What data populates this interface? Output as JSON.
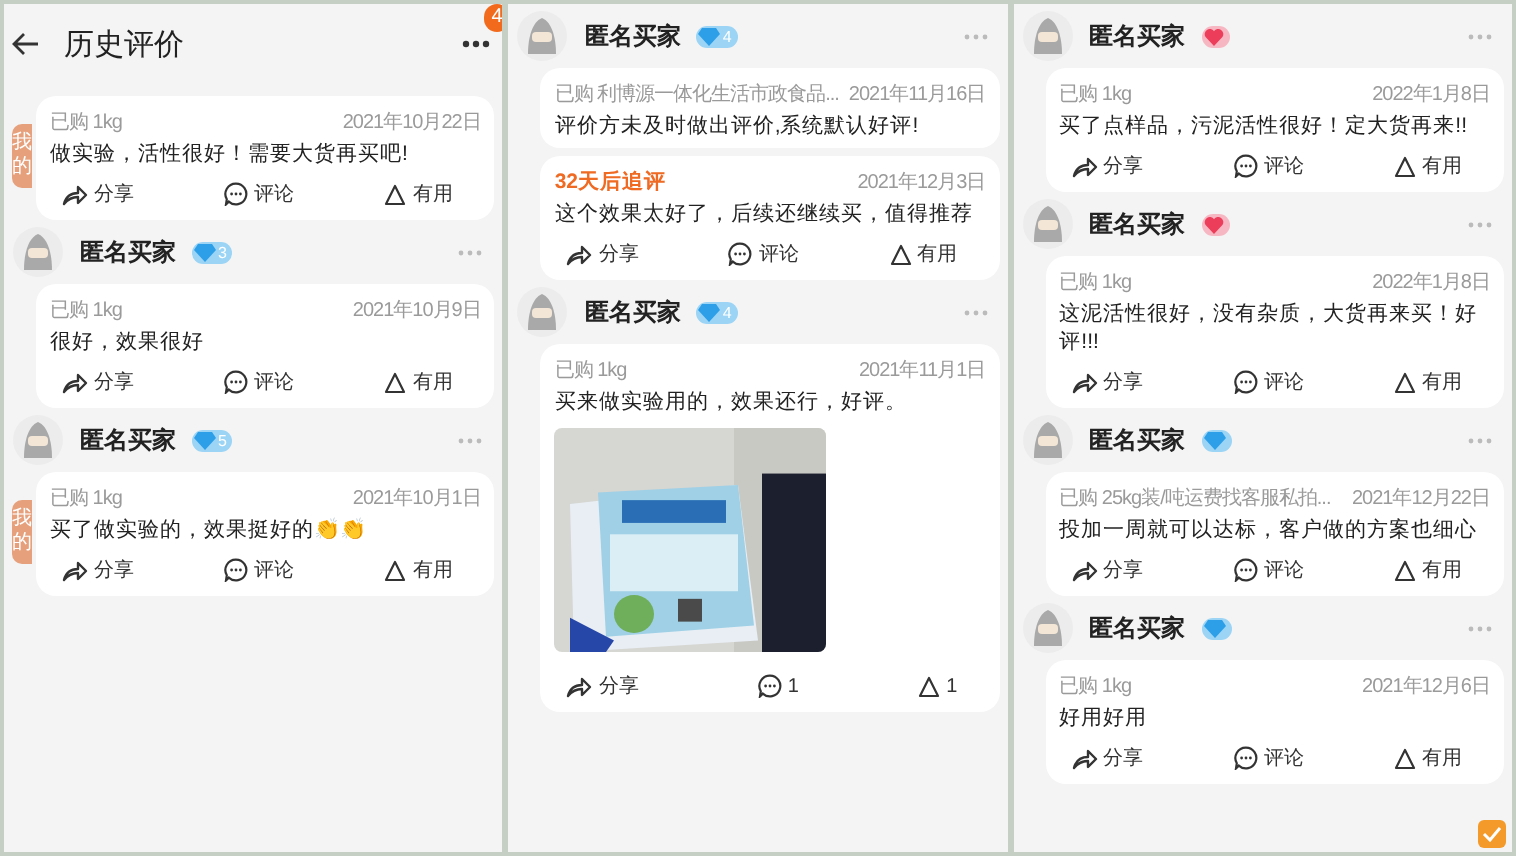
{
  "panels": [
    {
      "header": {
        "title": "历史评价",
        "badge": "4"
      },
      "reviews": [
        {
          "tag": "我的",
          "purchase": "已购 1kg",
          "date": "2021年10月22日",
          "text": "做实验，活性很好！需要大货再买吧!",
          "actions": [
            {
              "kind": "share",
              "label": "分享"
            },
            {
              "kind": "comment",
              "label": "评论"
            },
            {
              "kind": "useful",
              "label": "有用"
            }
          ]
        },
        {
          "user": {
            "name": "匿名买家",
            "badge": {
              "kind": "diamond",
              "level": "3"
            }
          },
          "purchase": "已购 1kg",
          "date": "2021年10月9日",
          "text": "很好，效果很好",
          "actions": [
            {
              "kind": "share",
              "label": "分享"
            },
            {
              "kind": "comment",
              "label": "评论"
            },
            {
              "kind": "useful",
              "label": "有用"
            }
          ]
        },
        {
          "user": {
            "name": "匿名买家",
            "badge": {
              "kind": "diamond",
              "level": "5"
            }
          },
          "tag": "我的",
          "purchase": "已购 1kg",
          "date": "2021年10月1日",
          "text": "买了做实验的，效果挺好的👏👏",
          "actions": [
            {
              "kind": "share",
              "label": "分享"
            },
            {
              "kind": "comment",
              "label": "评论"
            },
            {
              "kind": "useful",
              "label": "有用"
            }
          ]
        }
      ]
    },
    {
      "reviews": [
        {
          "user": {
            "name": "匿名买家",
            "badge": {
              "kind": "diamond",
              "level": "4"
            }
          },
          "purchase": "已购 利博源一体化生活市政食品...",
          "date": "2021年11月16日",
          "text": "评价方未及时做出评价,系统默认好评!",
          "followup": {
            "label": "32天后追评",
            "date": "2021年12月3日",
            "text": "这个效果太好了，后续还继续买，值得推荐"
          },
          "actions": [
            {
              "kind": "share",
              "label": "分享"
            },
            {
              "kind": "comment",
              "label": "评论"
            },
            {
              "kind": "useful",
              "label": "有用"
            }
          ]
        },
        {
          "user": {
            "name": "匿名买家",
            "badge": {
              "kind": "diamond",
              "level": "4"
            }
          },
          "purchase": "已购 1kg",
          "date": "2021年11月1日",
          "text": "买来做实验用的，效果还行，好评。",
          "photo": {
            "kind": "picture"
          },
          "actions": [
            {
              "kind": "share",
              "label": "分享"
            },
            {
              "kind": "comment",
              "label": "1"
            },
            {
              "kind": "useful",
              "label": "1"
            }
          ]
        }
      ]
    },
    {
      "check_button": true,
      "reviews": [
        {
          "user": {
            "name": "匿名买家",
            "badge": {
              "kind": "heart"
            }
          },
          "purchase": "已购 1kg",
          "date": "2022年1月8日",
          "text": "买了点样品，污泥活性很好！定大货再来!!",
          "actions": [
            {
              "kind": "share",
              "label": "分享"
            },
            {
              "kind": "comment",
              "label": "评论"
            },
            {
              "kind": "useful",
              "label": "有用"
            }
          ]
        },
        {
          "user": {
            "name": "匿名买家",
            "badge": {
              "kind": "heart"
            }
          },
          "purchase": "已购 1kg",
          "date": "2022年1月8日",
          "text": "这泥活性很好，没有杂质，大货再来买！好评!!!",
          "actions": [
            {
              "kind": "share",
              "label": "分享"
            },
            {
              "kind": "comment",
              "label": "评论"
            },
            {
              "kind": "useful",
              "label": "有用"
            }
          ]
        },
        {
          "user": {
            "name": "匿名买家",
            "badge": {
              "kind": "diamond"
            }
          },
          "purchase": "已购 25kg装/吨运费找客服私拍...",
          "date": "2021年12月22日",
          "text": "投加一周就可以达标，客户做的方案也细心",
          "actions": [
            {
              "kind": "share",
              "label": "分享"
            },
            {
              "kind": "comment",
              "label": "评论"
            },
            {
              "kind": "useful",
              "label": "有用"
            }
          ]
        },
        {
          "user": {
            "name": "匿名买家",
            "badge": {
              "kind": "diamond"
            }
          },
          "purchase": "已购 1kg",
          "date": "2021年12月6日",
          "text": "好用好用",
          "actions": [
            {
              "kind": "share",
              "label": "分享"
            },
            {
              "kind": "comment",
              "label": "评论"
            },
            {
              "kind": "useful",
              "label": "有用"
            }
          ]
        }
      ]
    }
  ]
}
